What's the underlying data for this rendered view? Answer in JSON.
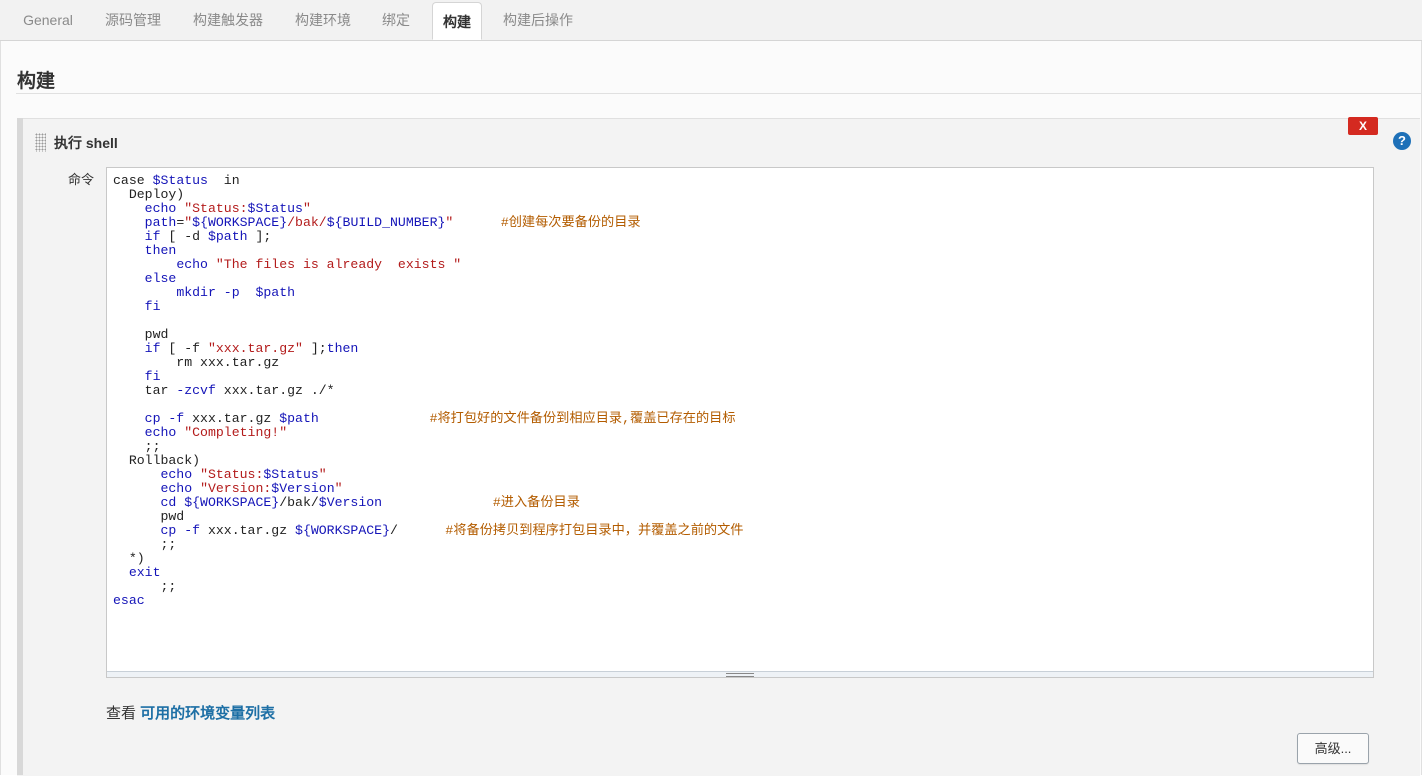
{
  "tabs": [
    {
      "label": "General"
    },
    {
      "label": "源码管理"
    },
    {
      "label": "构建触发器"
    },
    {
      "label": "构建环境"
    },
    {
      "label": "绑定"
    },
    {
      "label": "构建"
    },
    {
      "label": "构建后操作"
    }
  ],
  "active_tab": "构建",
  "section": {
    "title": "构建"
  },
  "build_step": {
    "title": "执行 shell",
    "delete_label": "X",
    "help_label": "?",
    "command_label": "命令",
    "command_lines": [
      "case $Status  in",
      "  Deploy)",
      "    echo \"Status:$Status\"",
      "    path=\"${WORKSPACE}/bak/${BUILD_NUMBER}\"      #创建每次要备份的目录",
      "    if [ -d $path ];",
      "    then",
      "        echo \"The files is already  exists \"",
      "    else",
      "        mkdir -p  $path",
      "    fi",
      "",
      "    pwd",
      "    if [ -f \"xxx.tar.gz\" ];then",
      "        rm xxx.tar.gz",
      "    fi",
      "    tar -zcvf xxx.tar.gz ./*",
      "",
      "    cp -f xxx.tar.gz $path              #将打包好的文件备份到相应目录,覆盖已存在的目标",
      "    echo \"Completing!\"",
      "    ;;",
      "  Rollback)",
      "      echo \"Status:$Status\"",
      "      echo \"Version:$Version\"",
      "      cd ${WORKSPACE}/bak/$Version              #进入备份目录",
      "      pwd",
      "      cp -f xxx.tar.gz ${WORKSPACE}/      #将备份拷贝到程序打包目录中，并覆盖之前的文件",
      "      ;;",
      "  *)",
      "  exit",
      "      ;;",
      "esac"
    ]
  },
  "env_vars": {
    "prefix": "查看 ",
    "link": "可用的环境变量列表"
  },
  "advanced_button": "高级..."
}
